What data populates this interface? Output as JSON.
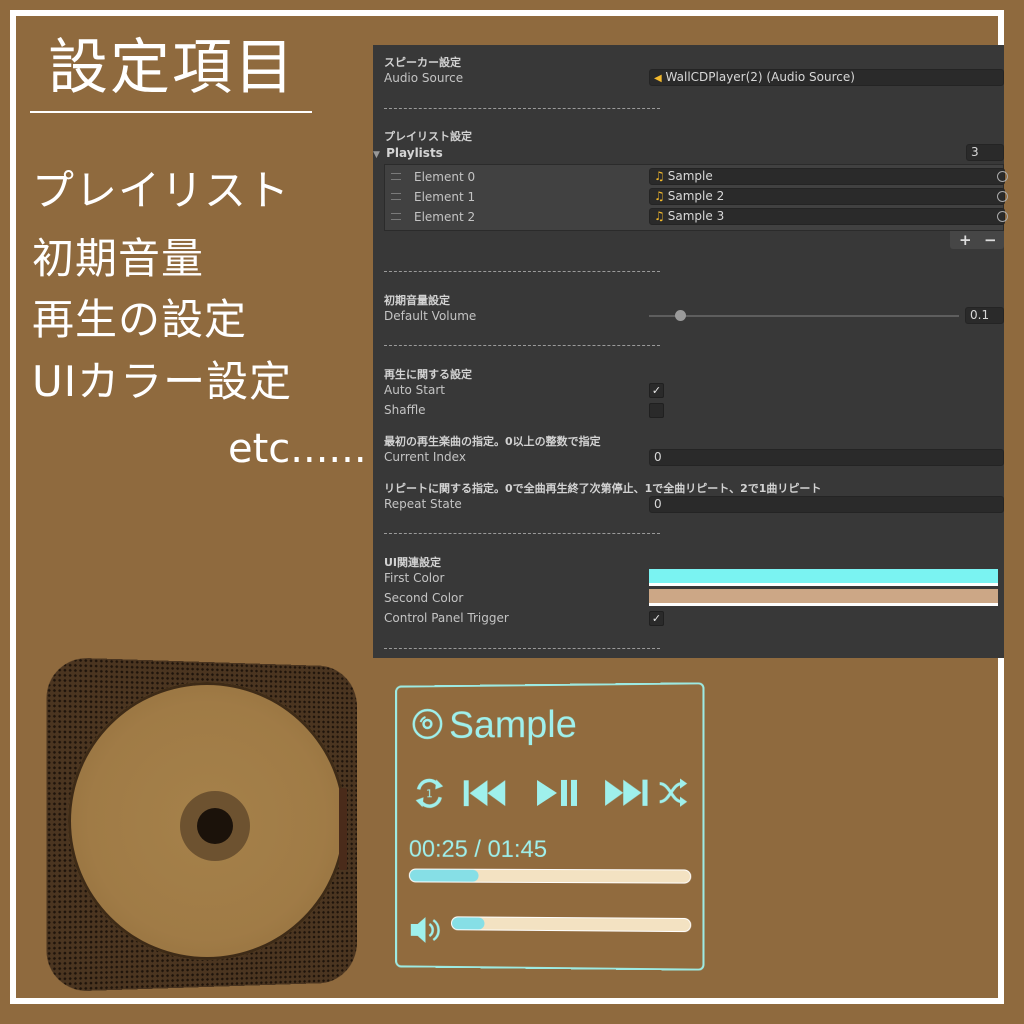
{
  "heading": {
    "title": "設定項目",
    "features": [
      "プレイリスト",
      "初期音量",
      "再生の設定",
      "UIカラー設定"
    ],
    "etc": "etc......"
  },
  "inspector": {
    "speaker_header": "スピーカー設定",
    "audio_source_label": "Audio Source",
    "audio_source_value": "WallCDPlayer(2) (Audio Source)",
    "playlist_header": "プレイリスト設定",
    "playlists_label": "Playlists",
    "playlists_count": "3",
    "elements": [
      {
        "label": "Element 0",
        "value": "Sample"
      },
      {
        "label": "Element 1",
        "value": "Sample 2"
      },
      {
        "label": "Element 2",
        "value": "Sample 3"
      }
    ],
    "plus": "+",
    "minus": "−",
    "volume_header": "初期音量設定",
    "default_volume_label": "Default Volume",
    "default_volume_value": "0.1",
    "default_volume_fraction": 0.1,
    "playback_header": "再生に関する設定",
    "auto_start_label": "Auto Start",
    "auto_start_checked": true,
    "shaffle_label": "Shaffle",
    "shaffle_checked": false,
    "index_header": "最初の再生楽曲の指定。0以上の整数で指定",
    "current_index_label": "Current Index",
    "current_index_value": "0",
    "repeat_header": "リピートに関する指定。0で全曲再生終了次第停止、1で全曲リピート、2で1曲リピート",
    "repeat_state_label": "Repeat State",
    "repeat_state_value": "0",
    "ui_header": "UI関連設定",
    "first_color_label": "First Color",
    "first_color": "#7af3f2",
    "second_color_label": "Second Color",
    "second_color": "#cca786",
    "control_panel_trigger_label": "Control Panel Trigger",
    "control_panel_trigger_checked": true,
    "separator": "--------------------------------------------"
  },
  "player": {
    "song_title": "Sample",
    "time": "00:25 / 01:45",
    "progress_fraction": 0.25,
    "volume_fraction": 0.14,
    "repeat_badge": "1",
    "icons": [
      "disc-icon",
      "repeat-one-icon",
      "previous-icon",
      "play-pause-icon",
      "next-icon",
      "shuffle-icon",
      "speaker-icon"
    ],
    "accent_color": "#9ff0ec"
  }
}
